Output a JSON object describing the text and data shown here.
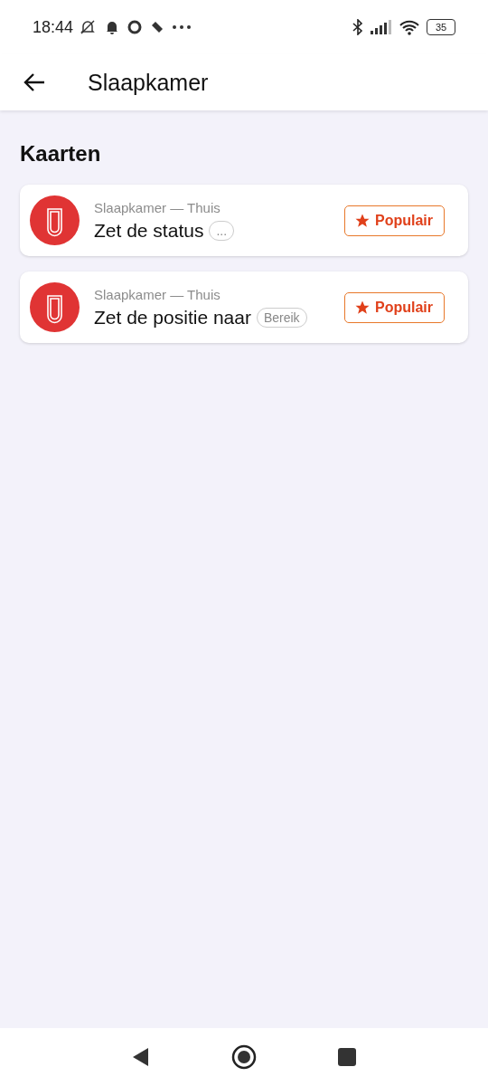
{
  "status_bar": {
    "time": "18:44",
    "battery": "35"
  },
  "app_bar": {
    "title": "Slaapkamer"
  },
  "section": {
    "title": "Kaarten"
  },
  "cards": [
    {
      "subtitle": "Slaapkamer — Thuis",
      "title": "Zet de status",
      "argument": "...",
      "badge": "Populair"
    },
    {
      "subtitle": "Slaapkamer — Thuis",
      "title": "Zet de positie naar",
      "argument": "Bereik",
      "badge": "Populair"
    }
  ]
}
